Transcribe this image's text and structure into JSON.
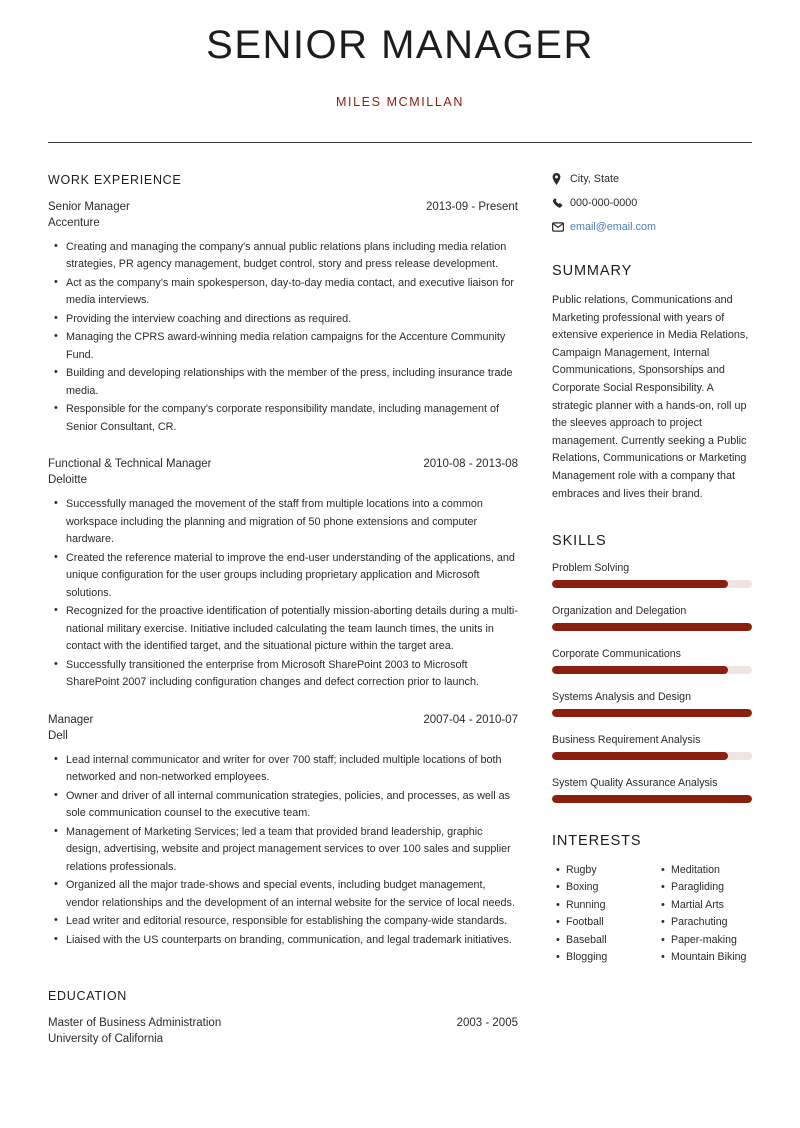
{
  "header": {
    "job_title": "SENIOR MANAGER",
    "name": "MILES MCMILLAN"
  },
  "accent_color": "#8b2010",
  "link_color": "#4a7ebb",
  "main": {
    "work_experience": {
      "heading": "WORK EXPERIENCE",
      "entries": [
        {
          "title": "Senior Manager",
          "date": "2013-09 - Present",
          "org": "Accenture",
          "bullets": [
            "Creating and managing the company's annual public relations plans including media relation strategies, PR agency management, budget control, story and press release development.",
            "Act as the company's main spokesperson, day-to-day media contact, and executive liaison for media interviews.",
            "Providing the interview coaching and directions as required.",
            "Managing the CPRS award-winning media relation campaigns for the Accenture Community Fund.",
            "Building and developing relationships with the member of the press, including insurance trade media.",
            "Responsible for the company's corporate responsibility mandate, including management of Senior Consultant, CR."
          ]
        },
        {
          "title": "Functional & Technical Manager",
          "date": "2010-08 - 2013-08",
          "org": "Deloitte",
          "bullets": [
            "Successfully managed the movement of the staff from multiple locations into a common workspace including the planning and migration of 50 phone extensions and computer hardware.",
            "Created the reference material to improve the end-user understanding of the applications, and unique configuration for the user groups including proprietary application and Microsoft solutions.",
            "Recognized for the proactive identification of potentially mission-aborting details during a multi-national military exercise. Initiative included calculating the team launch times, the units in contact with the identified target, and the situational picture within the target area.",
            "Successfully transitioned the enterprise from Microsoft SharePoint 2003 to Microsoft SharePoint 2007 including configuration changes and defect correction prior to launch."
          ]
        },
        {
          "title": "Manager",
          "date": "2007-04 - 2010-07",
          "org": "Dell",
          "bullets": [
            "Lead internal communicator and writer for over 700 staff; included multiple locations of both networked and non-networked employees.",
            "Owner and driver of all internal communication strategies, policies, and processes, as well as sole communication counsel to the executive team.",
            "Management of Marketing Services; led a team that provided brand leadership, graphic design, advertising, website and project management services to over 100 sales and supplier relations professionals.",
            "Organized all the major trade-shows and special events, including budget management, vendor relationships and the development of an internal website for the service of local needs.",
            "Lead writer and editorial resource, responsible for establishing the company-wide standards.",
            "Liaised with the US counterparts on branding, communication, and legal trademark initiatives."
          ]
        }
      ]
    },
    "education": {
      "heading": "EDUCATION",
      "entries": [
        {
          "title": "Master of Business Administration",
          "date": "2003 - 2005",
          "org": "University of California"
        }
      ]
    }
  },
  "sidebar": {
    "contact": [
      {
        "icon": "location-pin-icon",
        "text": "City, State",
        "is_link": false
      },
      {
        "icon": "phone-icon",
        "text": "000-000-0000",
        "is_link": false
      },
      {
        "icon": "envelope-icon",
        "text": "email@email.com",
        "is_link": true
      }
    ],
    "summary": {
      "heading": "SUMMARY",
      "text": "Public relations, Communications and Marketing professional with years of extensive experience in Media Relations, Campaign Management, Internal Communications, Sponsorships and Corporate Social Responsibility. A strategic planner with a hands-on, roll up the sleeves approach to project management. Currently seeking a Public Relations, Communications or Marketing Management role with a company that embraces and lives their brand."
    },
    "skills": {
      "heading": "SKILLS",
      "items": [
        {
          "name": "Problem Solving",
          "level": 88
        },
        {
          "name": "Organization and Delegation",
          "level": 100
        },
        {
          "name": "Corporate Communications",
          "level": 88
        },
        {
          "name": "Systems Analysis and Design",
          "level": 100
        },
        {
          "name": "Business Requirement Analysis",
          "level": 88
        },
        {
          "name": "System Quality Assurance Analysis",
          "level": 100
        }
      ]
    },
    "interests": {
      "heading": "INTERESTS",
      "column_left": [
        "Rugby",
        "Boxing",
        "Running",
        "Football",
        "Baseball",
        "Blogging"
      ],
      "column_right": [
        "Meditation",
        "Paragliding",
        "Martial Arts",
        "Parachuting",
        "Paper-making",
        "Mountain Biking"
      ]
    }
  }
}
